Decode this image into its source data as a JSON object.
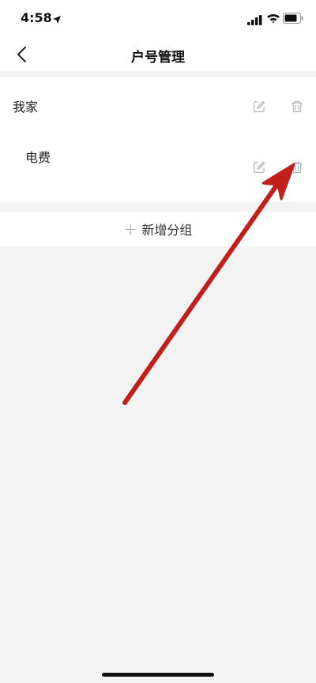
{
  "status_bar": {
    "time": "4:58",
    "icons": [
      "location-arrow-icon",
      "signal-icon",
      "wifi-icon",
      "battery-icon"
    ]
  },
  "nav": {
    "title": "户号管理",
    "back_icon": "chevron-left-icon"
  },
  "groups": [
    {
      "name": "我家",
      "accounts": [
        {
          "name": "电费"
        }
      ]
    }
  ],
  "add_group": {
    "label": "新增分组",
    "icon": "plus-icon"
  },
  "colors": {
    "background": "#f3f3f3",
    "surface": "#ffffff",
    "icon_gray": "#b5b5b5",
    "annotation_red": "#c0201c"
  }
}
